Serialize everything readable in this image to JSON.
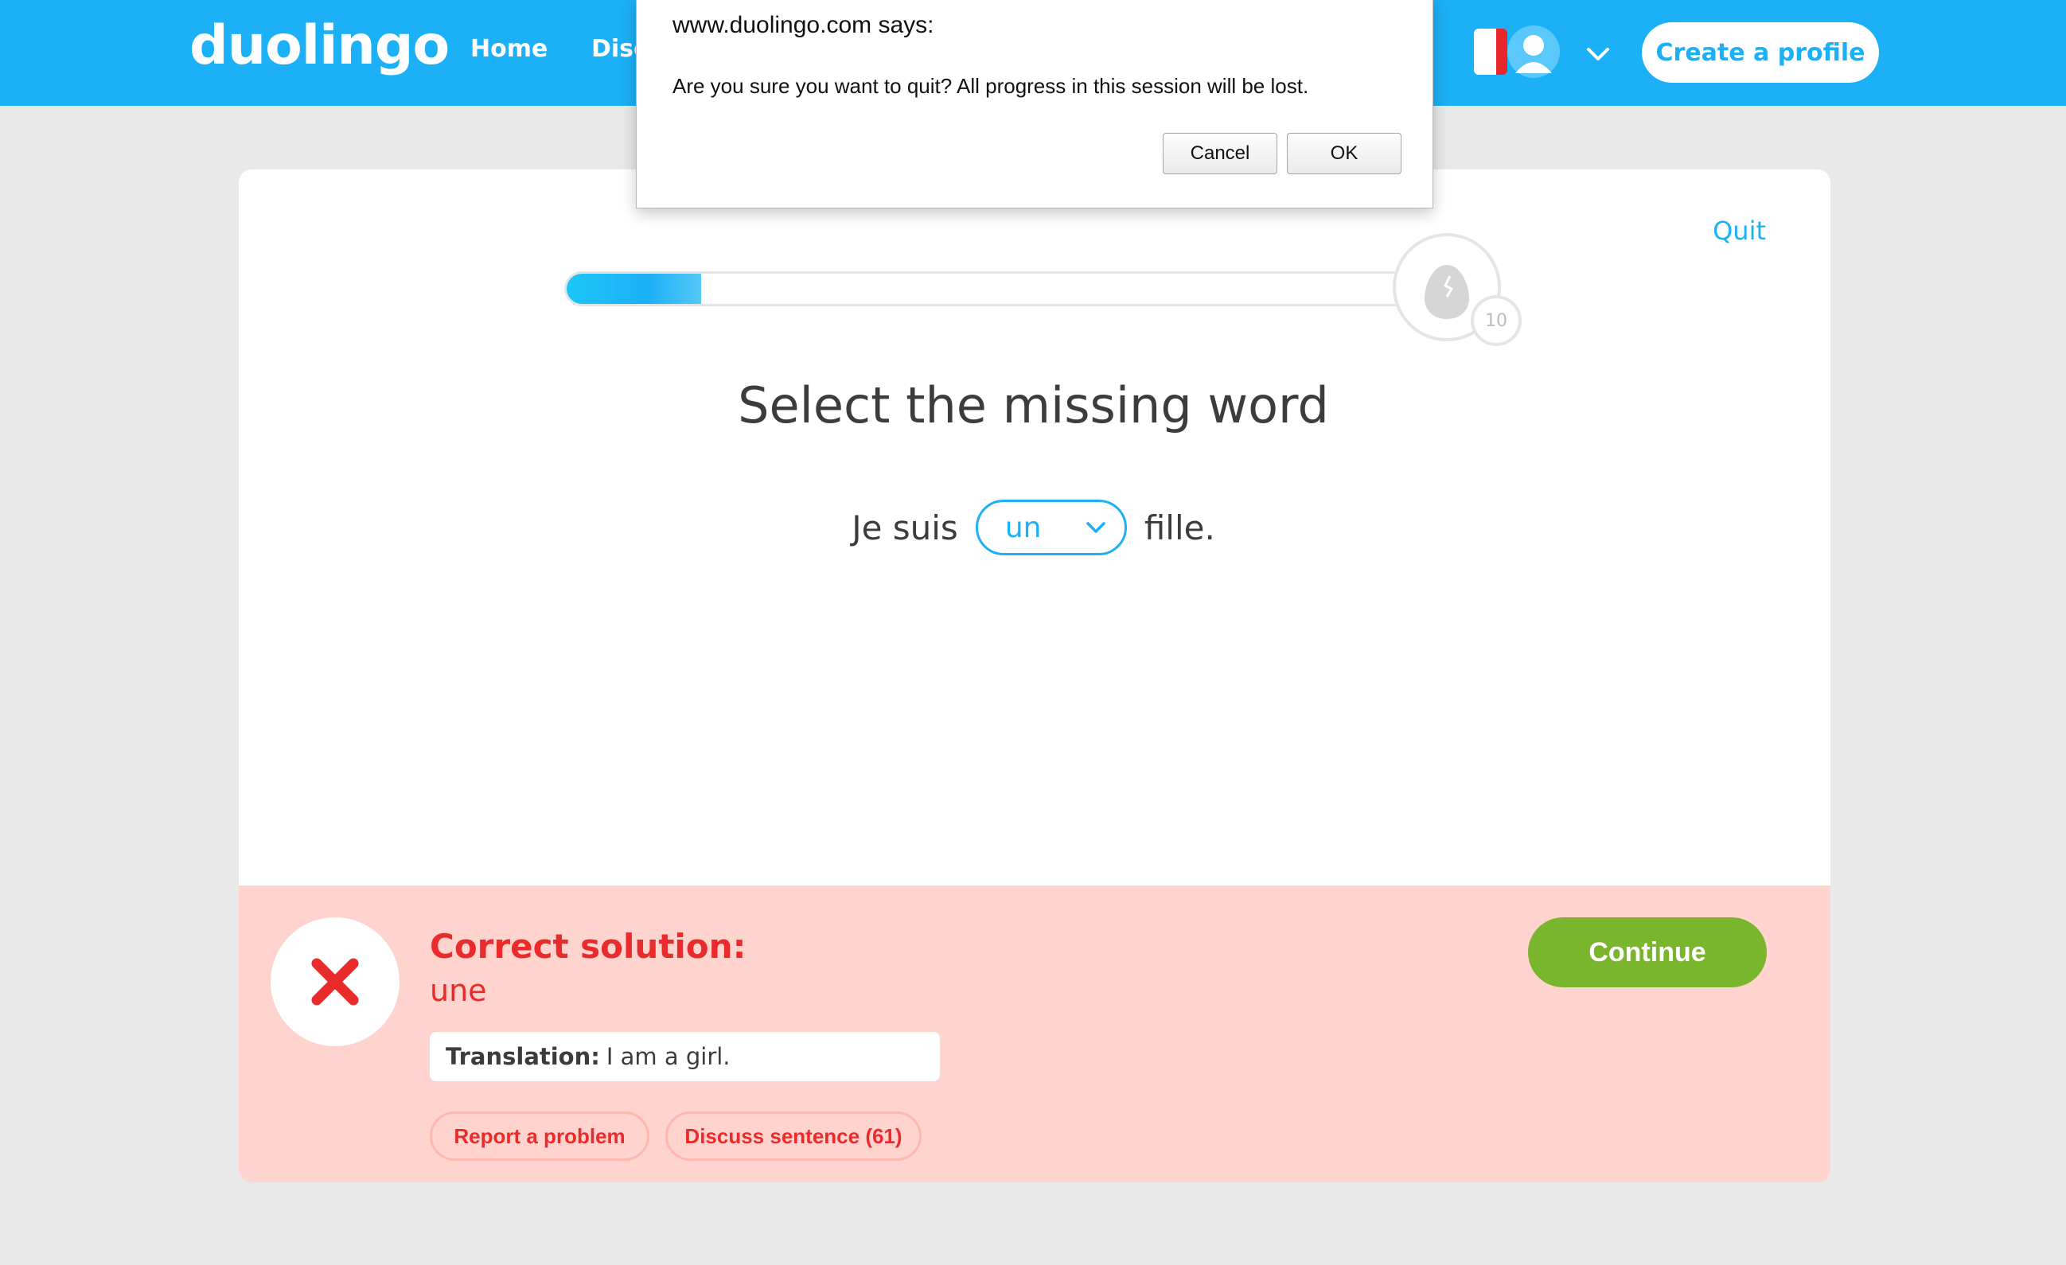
{
  "header": {
    "logo": "duolingo",
    "nav": [
      {
        "label": "Home"
      },
      {
        "label": "Disc"
      }
    ],
    "create_profile_label": "Create a profile"
  },
  "lesson": {
    "quit_label": "Quit",
    "progress_fraction": 0.16,
    "egg_count": "10",
    "prompt": "Select the missing word",
    "sentence_before": "Je suis",
    "selected_option": "un",
    "sentence_after": "fille."
  },
  "feedback": {
    "heading": "Correct solution:",
    "answer": "une",
    "translation_label": "Translation:",
    "translation_text": "I am a girl.",
    "report_label": "Report a problem",
    "discuss_label": "Discuss sentence (61)",
    "continue_label": "Continue"
  },
  "dialog": {
    "title": "www.duolingo.com says:",
    "message": "Are you sure you want to quit? All progress in this session will be lost.",
    "cancel_label": "Cancel",
    "ok_label": "OK"
  },
  "colors": {
    "brand_blue": "#1cb0f6",
    "error_red": "#ea2b2b",
    "feedback_bg": "#ffd3ce",
    "continue_green": "#7ab52e"
  }
}
